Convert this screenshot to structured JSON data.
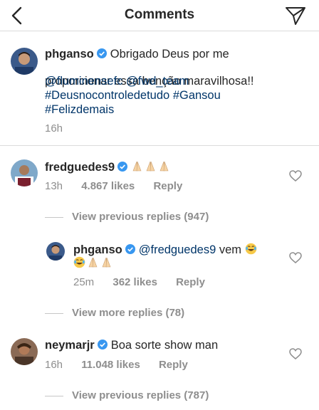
{
  "header": {
    "title": "Comments"
  },
  "caption": {
    "username": "phganso",
    "line1": "Obrigado Deus por me",
    "line2": "proporcionar essa benção maravilhosa!!",
    "mention1": "@fluminensefc",
    "mention2": "@fwd_team",
    "hashtag1": "#Deusnocontroledetudo",
    "hashtag2": "#Gansou",
    "hashtag3": "#Felizdemais",
    "time": "16h"
  },
  "comments": [
    {
      "username": "fredguedes9",
      "time": "13h",
      "likes": "4.867 likes",
      "reply": "Reply",
      "view_replies": "View previous replies (947)"
    },
    {
      "username": "phganso",
      "mention": "@fredguedes9",
      "text": "vem",
      "time": "25m",
      "likes": "362 likes",
      "reply": "Reply",
      "view_replies": "View more replies (78)"
    },
    {
      "username": "neymarjr",
      "text": "Boa sorte show man",
      "time": "16h",
      "likes": "11.048 likes",
      "reply": "Reply",
      "view_replies": "View previous replies (787)"
    }
  ],
  "icons": {
    "back": "chevron-left-icon",
    "send": "direct-send-icon",
    "verified": "verified-badge-icon",
    "heart": "heart-outline-icon",
    "praying_hands": "praying-hands-emoji",
    "laughing": "tears-of-joy-emoji"
  },
  "colors": {
    "link": "#003569",
    "verified": "#3897f0",
    "meta": "#8e8e8e",
    "divider": "#dbdbdb"
  }
}
